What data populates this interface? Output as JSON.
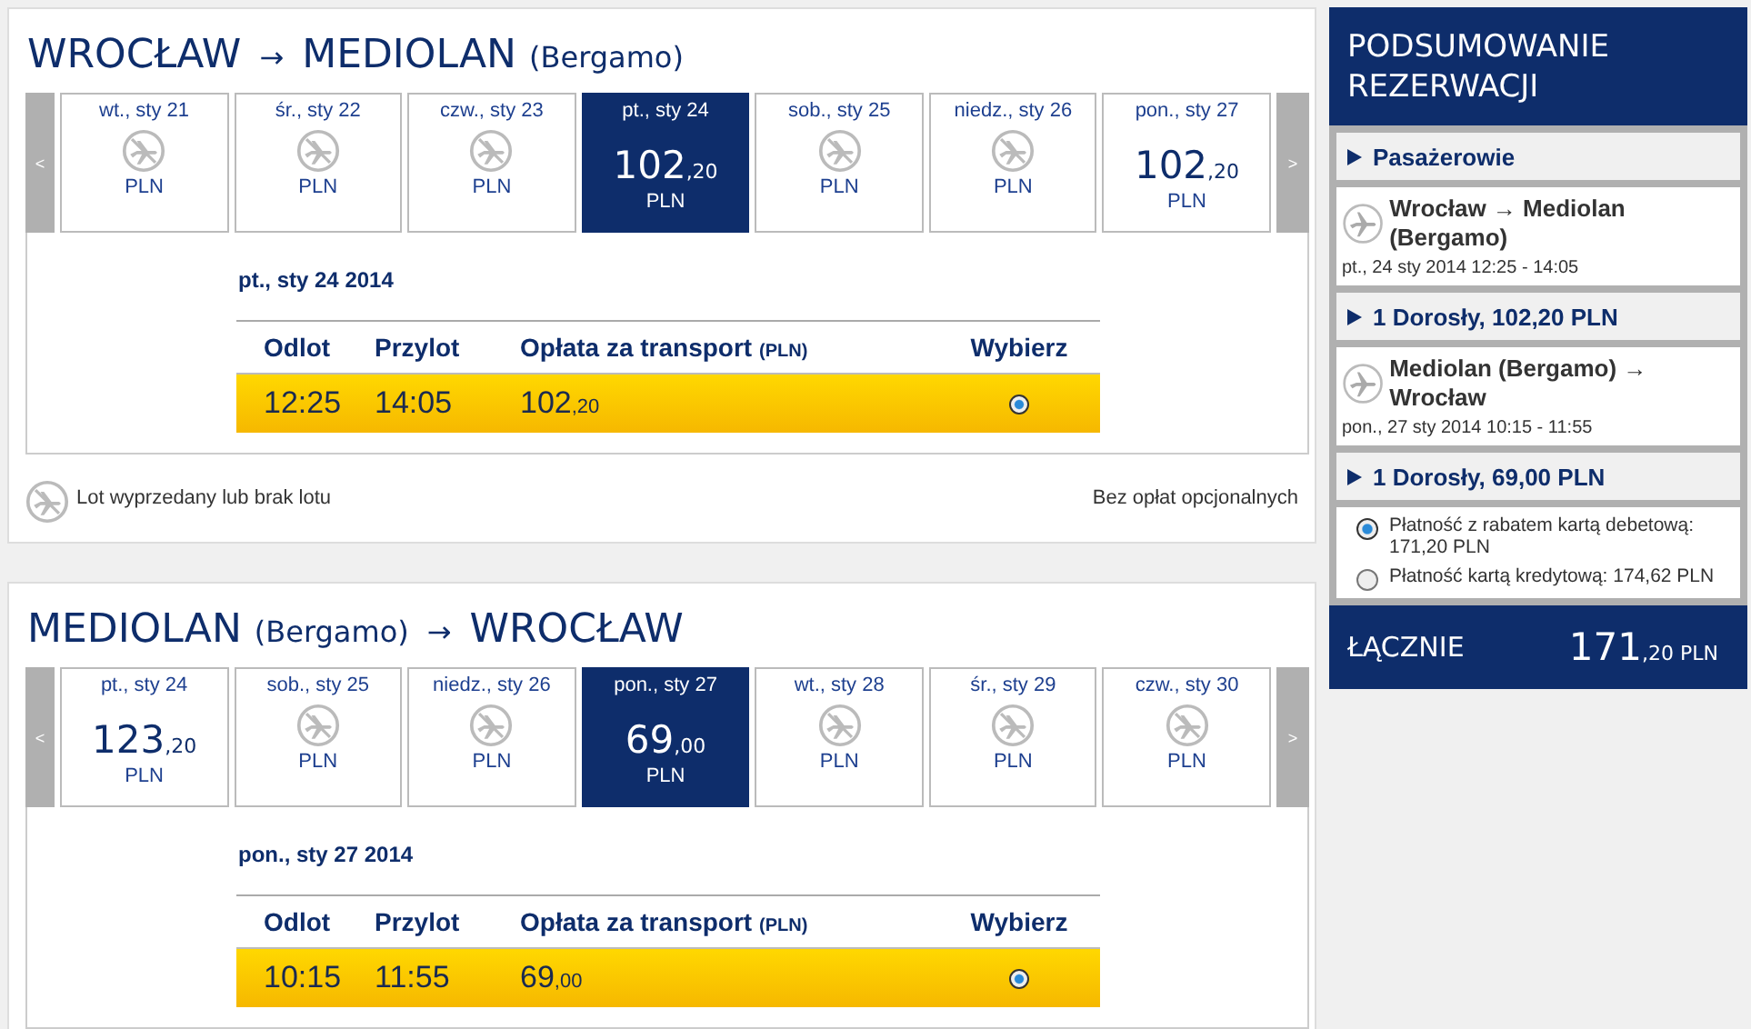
{
  "journeys": [
    {
      "title": {
        "from": "WROCŁAW",
        "arrow": "→",
        "to": "MEDIOLAN",
        "to_note": "(Bergamo)"
      },
      "prev": "<",
      "next": ">",
      "days": [
        {
          "label": "wt., sty 21",
          "kind": "unavailable",
          "currency": "PLN",
          "selected": false
        },
        {
          "label": "śr., sty 22",
          "kind": "unavailable",
          "currency": "PLN",
          "selected": false
        },
        {
          "label": "czw., sty 23",
          "kind": "unavailable",
          "currency": "PLN",
          "selected": false
        },
        {
          "label": "pt., sty 24",
          "kind": "available",
          "price_main": "102",
          "price_fraction": ",20",
          "currency": "PLN",
          "selected": true
        },
        {
          "label": "sob., sty 25",
          "kind": "unavailable",
          "currency": "PLN",
          "selected": false
        },
        {
          "label": "niedz., sty 26",
          "kind": "unavailable",
          "currency": "PLN",
          "selected": false
        },
        {
          "label": "pon., sty 27",
          "kind": "available",
          "price_main": "102",
          "price_fraction": ",20",
          "currency": "PLN",
          "selected": false
        }
      ],
      "date": "pt., sty 24 2014",
      "columns": [
        {
          "label": "Odlot"
        },
        {
          "label": "Przylot"
        },
        {
          "label": "Opłata za transport",
          "note": "(PLN)"
        },
        {
          "label": "Wybierz"
        }
      ],
      "flights": [
        {
          "departure": "12:25",
          "arrival": "14:05",
          "price_main": "102",
          "price_fraction": ",20",
          "selected": true
        }
      ],
      "legend": "Lot wyprzedany lub brak lotu",
      "fees_note": "Bez opłat opcjonalnych"
    },
    {
      "title": {
        "from": "MEDIOLAN",
        "from_note": "(Bergamo)",
        "arrow": "→",
        "to": "WROCŁAW"
      },
      "prev": "<",
      "next": ">",
      "days": [
        {
          "label": "pt., sty 24",
          "kind": "available",
          "price_main": "123",
          "price_fraction": ",20",
          "currency": "PLN",
          "selected": false
        },
        {
          "label": "sob., sty 25",
          "kind": "unavailable",
          "currency": "PLN",
          "selected": false
        },
        {
          "label": "niedz., sty 26",
          "kind": "unavailable",
          "currency": "PLN",
          "selected": false
        },
        {
          "label": "pon., sty 27",
          "kind": "available",
          "price_main": "69",
          "price_fraction": ",00",
          "currency": "PLN",
          "selected": true
        },
        {
          "label": "wt., sty 28",
          "kind": "unavailable",
          "currency": "PLN",
          "selected": false
        },
        {
          "label": "śr., sty 29",
          "kind": "unavailable",
          "currency": "PLN",
          "selected": false
        },
        {
          "label": "czw., sty 30",
          "kind": "unavailable",
          "currency": "PLN",
          "selected": false
        }
      ],
      "date": "pon., sty 27 2014",
      "columns": [
        {
          "label": "Odlot"
        },
        {
          "label": "Przylot"
        },
        {
          "label": "Opłata za transport",
          "note": "(PLN)"
        },
        {
          "label": "Wybierz"
        }
      ],
      "flights": [
        {
          "departure": "10:15",
          "arrival": "11:55",
          "price_main": "69",
          "price_fraction": ",00",
          "selected": true
        }
      ]
    }
  ],
  "summary": {
    "title": "PODSUMOWANIE REZERWACJI",
    "sections": [
      {
        "kind": "expander",
        "label": "Pasażerowie"
      },
      {
        "kind": "segment",
        "route": "Wrocław → Mediolan (Bergamo)",
        "when": "pt., 24 sty 2014 12:25 - 14:05"
      },
      {
        "kind": "expander",
        "label": "1 Dorosły, 102,20 PLN"
      },
      {
        "kind": "segment",
        "route": "Mediolan (Bergamo) → Wrocław",
        "when": "pon., 27 sty 2014 10:15 - 11:55"
      },
      {
        "kind": "expander",
        "label": "1 Dorosły, 69,00 PLN"
      }
    ],
    "payment_options": [
      {
        "label": "Płatność z rabatem kartą debetową: 171,20 PLN",
        "selected": true
      },
      {
        "label": "Płatność kartą kredytową: 174,62 PLN",
        "selected": false
      }
    ],
    "total": {
      "label": "ŁĄCZNIE",
      "amount_main": "171",
      "amount_fraction": ",20",
      "currency": "PLN"
    }
  }
}
